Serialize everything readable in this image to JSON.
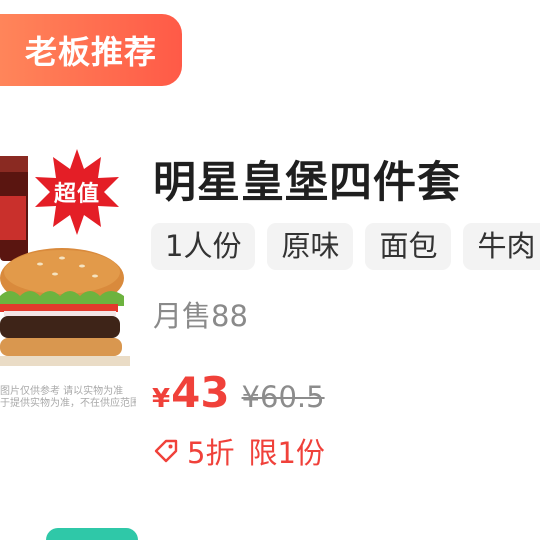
{
  "badge": {
    "label": "老板推荐"
  },
  "product": {
    "title": "明星皇堡四件套",
    "starburst_label": "超值",
    "image_note_lines": [
      "图片仅供参考 请以实物为准",
      "于提供实物为准，不在供应范围之内。"
    ],
    "tags": [
      "1人份",
      "原味",
      "面包",
      "牛肉"
    ],
    "sales": "月售88",
    "currency": "¥",
    "price": "43",
    "original_price": "¥60.5",
    "discount": "5折",
    "limit": "限1份"
  },
  "colors": {
    "badge_gradient_start": "#ff8a5c",
    "badge_gradient_end": "#ff5a47",
    "price_red": "#f0413a",
    "tag_bg": "#f3f3f3",
    "next_badge": "#2fc8a8"
  },
  "icons": [
    "starburst-icon",
    "discount-tag-icon"
  ]
}
